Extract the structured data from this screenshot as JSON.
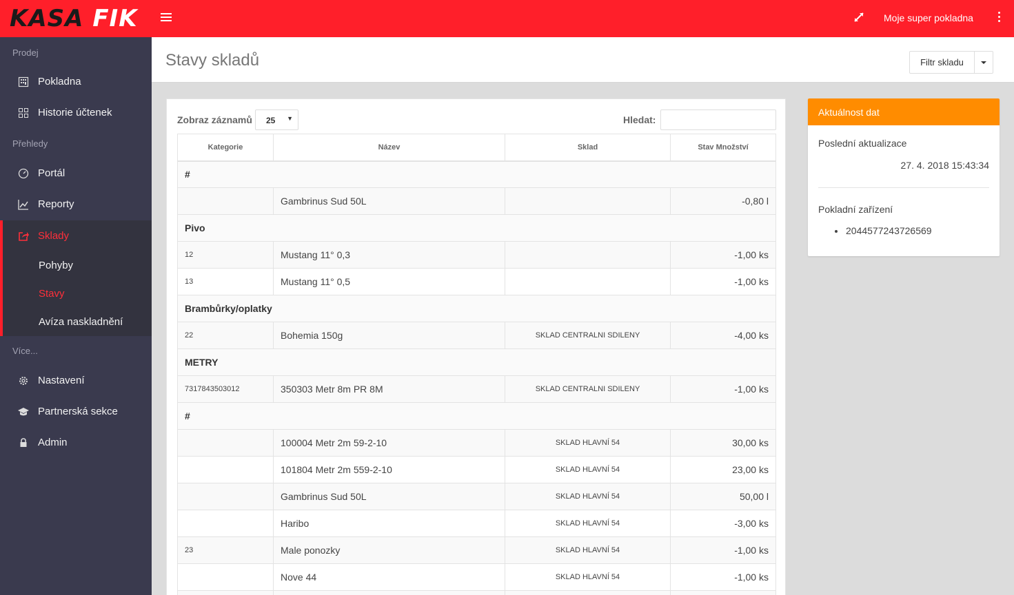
{
  "app": {
    "logo_part1": "KASA",
    "logo_part2": "FIK",
    "shop_name": "Moje super pokladna"
  },
  "sidebar": {
    "sections": {
      "prodej": "Prodej",
      "prehledy": "Přehledy",
      "vice": "Více..."
    },
    "items": {
      "pokladna": "Pokladna",
      "historie": "Historie účtenek",
      "portal": "Portál",
      "reporty": "Reporty",
      "sklady": "Sklady",
      "pohyby": "Pohyby",
      "stavy": "Stavy",
      "aviza": "Avíza naskladnění",
      "nastaveni": "Nastavení",
      "partnerska": "Partnerská sekce",
      "admin": "Admin"
    },
    "active_item": "sklady",
    "active_subitem": "stavy",
    "accent_color": "#ff2f3a"
  },
  "header": {
    "title": "Stavy skladů",
    "filter_label": "Filtr skladu"
  },
  "table": {
    "length_label": "Zobraz záznamů",
    "length_value": "25",
    "search_label": "Hledat:",
    "search_value": "",
    "columns": [
      "Kategorie",
      "Název",
      "Sklad",
      "Stav Množství"
    ],
    "rows": [
      {
        "type": "group",
        "label": "#"
      },
      {
        "type": "item",
        "code": "",
        "name": "Gambrinus Sud 50L",
        "sklad": "",
        "qty": "-0,80 l"
      },
      {
        "type": "group",
        "label": "Pivo"
      },
      {
        "type": "item",
        "code": "12",
        "name": "Mustang 11° 0,3",
        "sklad": "",
        "qty": "-1,00 ks"
      },
      {
        "type": "item",
        "code": "13",
        "name": "Mustang 11° 0,5",
        "sklad": "",
        "qty": "-1,00 ks"
      },
      {
        "type": "group",
        "label": "Brambůrky/oplatky"
      },
      {
        "type": "item",
        "code": "22",
        "name": "Bohemia 150g",
        "sklad": "SKLAD CENTRALNI SDILENY",
        "qty": "-4,00 ks"
      },
      {
        "type": "group",
        "label": "METRY"
      },
      {
        "type": "item",
        "code": "7317843503012",
        "name": "350303 Metr 8m PR 8M",
        "sklad": "SKLAD CENTRALNI SDILENY",
        "qty": "-1,00 ks"
      },
      {
        "type": "group",
        "label": "#"
      },
      {
        "type": "item",
        "code": "",
        "name": "100004 Metr 2m 59-2-10",
        "sklad": "SKLAD HLAVNÍ 54",
        "qty": "30,00 ks"
      },
      {
        "type": "item",
        "code": "",
        "name": "101804 Metr 2m 559-2-10",
        "sklad": "SKLAD HLAVNÍ 54",
        "qty": "23,00 ks"
      },
      {
        "type": "item",
        "code": "",
        "name": "Gambrinus Sud 50L",
        "sklad": "SKLAD HLAVNÍ 54",
        "qty": "50,00 l"
      },
      {
        "type": "item",
        "code": "",
        "name": "Haribo",
        "sklad": "SKLAD HLAVNÍ 54",
        "qty": "-3,00 ks"
      },
      {
        "type": "item",
        "code": "23",
        "name": "Male ponozky",
        "sklad": "SKLAD HLAVNÍ 54",
        "qty": "-1,00 ks"
      },
      {
        "type": "item",
        "code": "",
        "name": "Nove 44",
        "sklad": "SKLAD HLAVNÍ 54",
        "qty": "-1,00 ks"
      },
      {
        "type": "item",
        "code": "",
        "name": "",
        "sklad": "",
        "qty": ""
      }
    ]
  },
  "panel": {
    "title": "Aktuálnost dat",
    "last_update_label": "Poslední aktualizace",
    "last_update_value": "27. 4. 2018 15:43:34",
    "devices_label": "Pokladní zařízení",
    "devices": [
      "2044577243726569"
    ],
    "header_color": "#ff8c00"
  }
}
